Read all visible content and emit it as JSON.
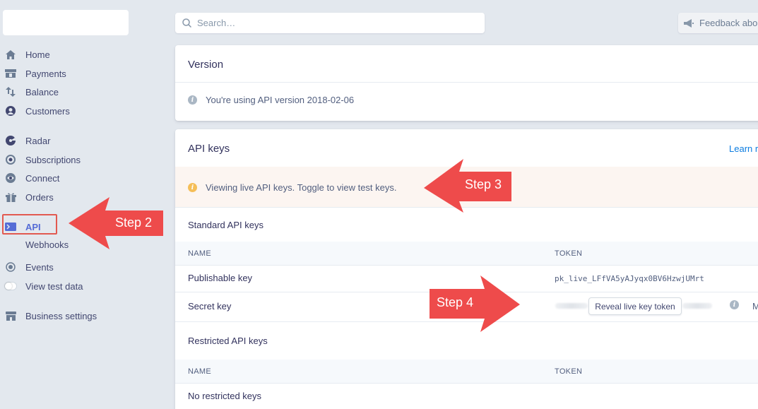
{
  "search": {
    "placeholder": "Search…"
  },
  "feedback": {
    "label": "Feedback about"
  },
  "sidebar": {
    "items": [
      {
        "label": "Home",
        "icon": "home-icon"
      },
      {
        "label": "Payments",
        "icon": "payments-icon"
      },
      {
        "label": "Balance",
        "icon": "balance-icon"
      },
      {
        "label": "Customers",
        "icon": "customers-icon"
      },
      {
        "label": "Radar",
        "icon": "radar-icon"
      },
      {
        "label": "Subscriptions",
        "icon": "subscriptions-icon"
      },
      {
        "label": "Connect",
        "icon": "connect-icon"
      },
      {
        "label": "Orders",
        "icon": "orders-icon"
      },
      {
        "label": "API",
        "icon": "api-icon",
        "active": true
      },
      {
        "label": "Webhooks"
      },
      {
        "label": "Events",
        "icon": "events-icon"
      },
      {
        "label": "View test data",
        "icon": "toggle-icon"
      },
      {
        "label": "Business settings",
        "icon": "business-icon"
      }
    ]
  },
  "version_card": {
    "title": "Version",
    "message": "You're using API version 2018-02-06"
  },
  "api_keys_card": {
    "title": "API keys",
    "learn_link": "Learn r",
    "banner": "Viewing live API keys. Toggle to view test keys.",
    "standard_section": "Standard API keys",
    "columns": {
      "name": "NAME",
      "token": "TOKEN"
    },
    "standard_rows": [
      {
        "name": "Publishable key",
        "token": "pk_live_LFfVA5yAJyqx0BV6HzwjUMrt"
      },
      {
        "name": "Secret key",
        "token_button": "Reveal live key token",
        "more": "M"
      }
    ],
    "restricted_section": "Restricted API keys",
    "restricted_empty": "No restricted keys"
  },
  "annotations": {
    "step2": "Step 2",
    "step3": "Step 3",
    "step4": "Step 4"
  },
  "colors": {
    "accent": "#556cd6",
    "arrow": "#ee4b4b",
    "highlight": "#e25950",
    "background": "#e3e8ee"
  }
}
